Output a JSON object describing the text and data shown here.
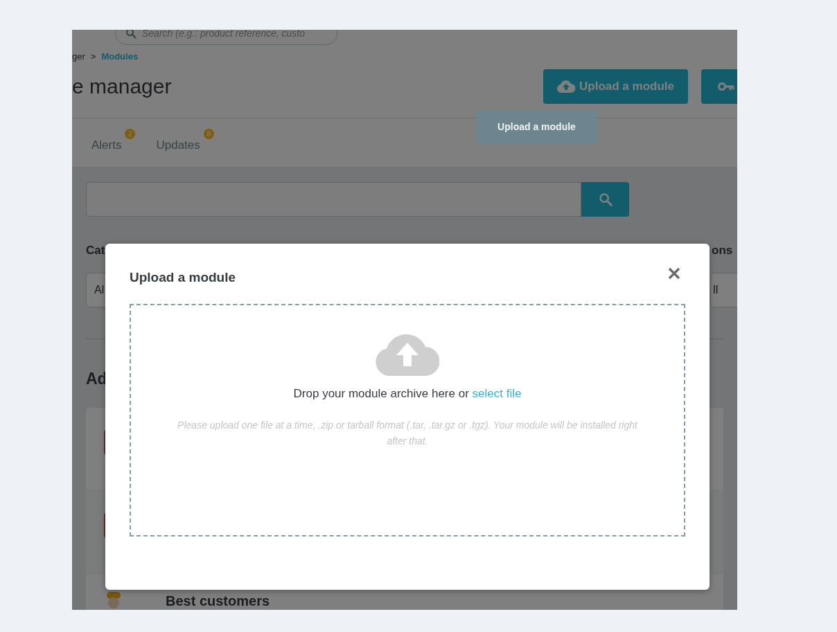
{
  "header": {
    "search_placeholder": "Search (e.g.: product reference, custo",
    "breadcrumb": [
      {
        "label": "ger",
        "selected": false
      },
      {
        "label": "Modules",
        "selected": true
      }
    ],
    "breadcrumb_separator": ">",
    "title": "e manager",
    "buttons": [
      {
        "kind": "upload",
        "label": "Upload a module"
      },
      {
        "kind": "key"
      }
    ],
    "tooltip": "Upload a module"
  },
  "tabs": [
    {
      "label": "Alerts",
      "badge": "2"
    },
    {
      "label": "Updates",
      "badge": "8"
    }
  ],
  "filters": [
    {
      "label": "Cat",
      "value": "Al"
    },
    {
      "label": "ons",
      "value": "ll"
    }
  ],
  "section_heading": "Ad",
  "module_rows": [
    {
      "kind": "partial"
    },
    {
      "kind": "partial"
    },
    {
      "kind": "titled",
      "name": "Best customers"
    }
  ],
  "modal": {
    "title": "Upload a module",
    "drop_text": "Drop your module archive here or ",
    "drop_link": "select file",
    "hint": "Please upload one file at a time, .zip or tarball format (.tar, .tar.gz or .tgz). Your module will be installed right after that."
  }
}
